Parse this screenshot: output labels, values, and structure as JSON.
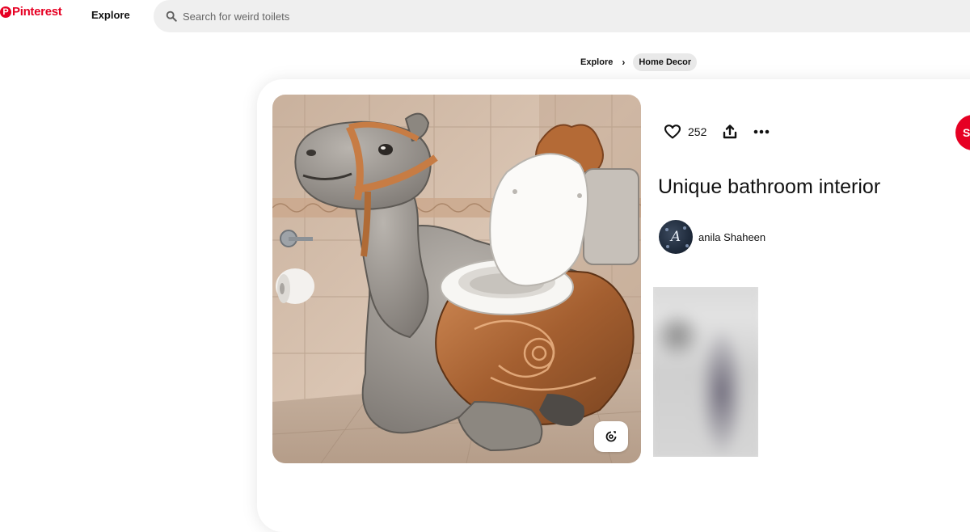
{
  "header": {
    "logo_text": "Pinterest",
    "logo_mark": "P",
    "nav_explore": "Explore",
    "search": {
      "placeholder": "Search for weird toilets",
      "value": ""
    }
  },
  "breadcrumb": {
    "items": [
      "Explore",
      "Home Decor"
    ],
    "separator": "›"
  },
  "pin": {
    "title": "Unique bathroom interior",
    "like_count": "252",
    "save_label": "S",
    "creator": {
      "name": "anila Shaheen",
      "avatar_letter": "A"
    },
    "image_alt": "Camel-shaped toilet in a tiled bathroom"
  },
  "colors": {
    "brand": "#e60023",
    "search_bg": "#efefef",
    "crumb_bg": "#e9e9e9"
  },
  "icons": {
    "logo": "pinterest-logo-icon",
    "search": "search-icon",
    "like": "heart-icon",
    "share": "share-icon",
    "more": "more-icon",
    "visual_search": "visual-search-icon"
  }
}
